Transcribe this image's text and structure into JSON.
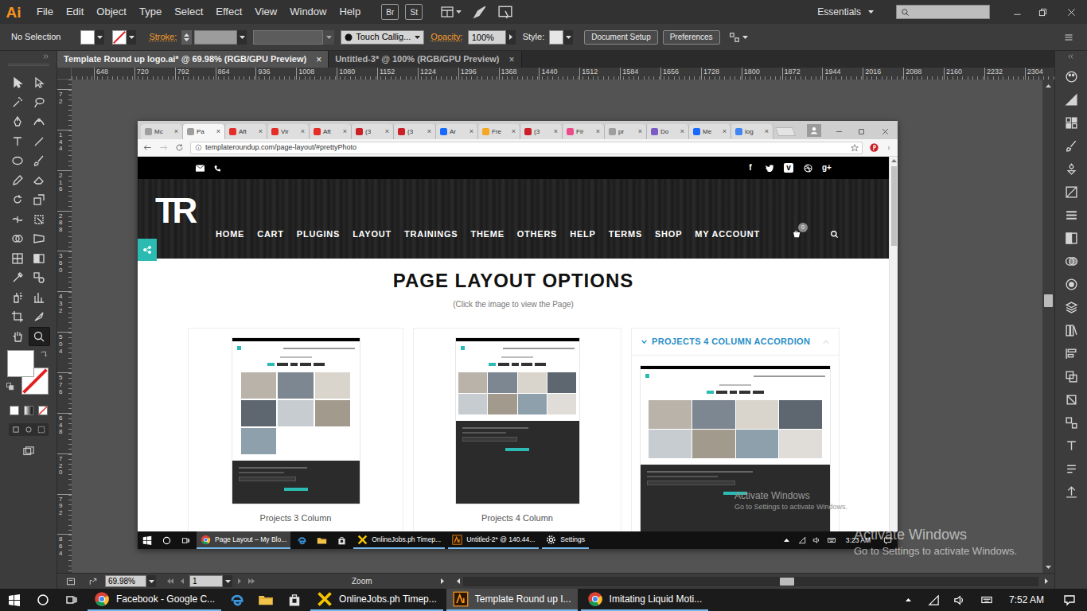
{
  "app": {
    "logo": "Ai",
    "menus": [
      "File",
      "Edit",
      "Object",
      "Type",
      "Select",
      "Effect",
      "View",
      "Window",
      "Help"
    ],
    "bridge": "Br",
    "stock": "St",
    "workspace": "Essentials"
  },
  "control_bar": {
    "selection": "No Selection",
    "fill": {
      "none": false
    },
    "stroke": {
      "none": true
    },
    "stroke_label": "Stroke:",
    "brush": "Touch Callig...",
    "opacity_label": "Opacity:",
    "opacity": "100%",
    "style_label": "Style:",
    "buttons": [
      "Document Setup",
      "Preferences"
    ]
  },
  "doc_tabs": [
    {
      "label": "Template Round up logo.ai* @ 69.98% (RGB/GPU Preview)",
      "close": "×",
      "selected": true
    },
    {
      "label": "Untitled-3* @ 100% (RGB/GPU Preview)",
      "close": "×",
      "selected": false
    }
  ],
  "tools": [
    {
      "kind": "selection",
      "selected": false
    },
    {
      "kind": "direct-selection",
      "selected": false
    },
    {
      "kind": "magic-wand",
      "selected": false
    },
    {
      "kind": "lasso",
      "selected": false
    },
    {
      "kind": "pen",
      "selected": false
    },
    {
      "kind": "curvature",
      "selected": false
    },
    {
      "kind": "type",
      "selected": false
    },
    {
      "kind": "line",
      "selected": false
    },
    {
      "kind": "ellipse",
      "selected": false
    },
    {
      "kind": "paintbrush",
      "selected": false
    },
    {
      "kind": "pencil",
      "selected": false
    },
    {
      "kind": "eraser",
      "selected": false
    },
    {
      "kind": "rotate",
      "selected": false
    },
    {
      "kind": "scale",
      "selected": false
    },
    {
      "kind": "width",
      "selected": false
    },
    {
      "kind": "free-transform",
      "selected": false
    },
    {
      "kind": "shape-builder",
      "selected": false
    },
    {
      "kind": "perspective",
      "selected": false
    },
    {
      "kind": "mesh",
      "selected": false
    },
    {
      "kind": "gradient",
      "selected": false
    },
    {
      "kind": "eyedropper",
      "selected": false
    },
    {
      "kind": "blend",
      "selected": false
    },
    {
      "kind": "symbol-sprayer",
      "selected": false
    },
    {
      "kind": "graph",
      "selected": false
    },
    {
      "kind": "artboard",
      "selected": false
    },
    {
      "kind": "slice",
      "selected": false
    },
    {
      "kind": "hand",
      "selected": false
    },
    {
      "kind": "zoom",
      "selected": true
    }
  ],
  "toolbox": {
    "fill": {
      "none": false
    },
    "stroke": {
      "none": true
    }
  },
  "rulers": {
    "horizontal": [
      "648",
      "720",
      "792",
      "864",
      "936",
      "1008",
      "1080",
      "1152",
      "1224",
      "1296",
      "1368",
      "1440",
      "1512",
      "1584",
      "1656",
      "1728",
      "1800",
      "1872",
      "1944",
      "2016",
      "2088",
      "2160",
      "2232",
      "2304"
    ],
    "vertical": [
      "72",
      "144",
      "216",
      "288",
      "360",
      "432",
      "504",
      "576",
      "648",
      "720",
      "792",
      "864"
    ]
  },
  "status_bar": {
    "zoom": "69.98%",
    "artboard": "1",
    "tool": "Zoom"
  },
  "browser": {
    "tabs": [
      {
        "label": "Mc",
        "close": "×",
        "selected": false,
        "color": "#9e9e9e"
      },
      {
        "label": "Pa",
        "close": "×",
        "selected": true,
        "color": "#9e9e9e"
      },
      {
        "label": "Aft",
        "close": "×",
        "selected": false,
        "color": "#e52d27"
      },
      {
        "label": "Vir",
        "close": "×",
        "selected": false,
        "color": "#e52d27"
      },
      {
        "label": "Aft",
        "close": "×",
        "selected": false,
        "color": "#e52d27"
      },
      {
        "label": "(3",
        "close": "×",
        "selected": false,
        "color": "#cb2027"
      },
      {
        "label": "(3",
        "close": "×",
        "selected": false,
        "color": "#cb2027"
      },
      {
        "label": "Ar",
        "close": "×",
        "selected": false,
        "color": "#1769ff"
      },
      {
        "label": "Fre",
        "close": "×",
        "selected": false,
        "color": "#f5a623"
      },
      {
        "label": "(3",
        "close": "×",
        "selected": false,
        "color": "#cb2027"
      },
      {
        "label": "Fir",
        "close": "×",
        "selected": false,
        "color": "#ea4c89"
      },
      {
        "label": "pr",
        "close": "×",
        "selected": false,
        "color": "#9e9e9e"
      },
      {
        "label": "Do",
        "close": "×",
        "selected": false,
        "color": "#7b5cc4"
      },
      {
        "label": "Me",
        "close": "×",
        "selected": false,
        "color": "#1769ff"
      },
      {
        "label": "log",
        "close": "×",
        "selected": false,
        "color": "#4285f4"
      }
    ],
    "url": "templateroundup.com/page-layout/#prettyPhoto",
    "site": {
      "logo": "TR",
      "social": [
        {
          "kind": "facebook",
          "glyph": "f"
        },
        {
          "kind": "twitter"
        },
        {
          "kind": "vimeo",
          "glyph": "v"
        },
        {
          "kind": "dribbble"
        },
        {
          "kind": "google-plus",
          "glyph": "g+"
        }
      ],
      "nav": [
        "HOME",
        "CART",
        "PLUGINS",
        "LAYOUT",
        "TRAININGS",
        "THEME",
        "OTHERS",
        "HELP",
        "TERMS",
        "SHOP",
        "MY ACCOUNT"
      ],
      "cart_count": "0",
      "heading": "PAGE LAYOUT OPTIONS",
      "subheading": "(Click the image to view the Page)",
      "cards": [
        {
          "caption": "Projects 3 Column",
          "kind": "three-column"
        },
        {
          "caption": "Projects 4 Column",
          "kind": "four-column"
        }
      ],
      "accordion": {
        "title": "PROJECTS 4 COLUMN ACCORDION",
        "expanded": true
      }
    },
    "taskbar": {
      "items": [
        {
          "kind": "chrome",
          "label": "Page Layout – My Blo...",
          "selected": true
        },
        {
          "kind": "edge",
          "selected": false
        },
        {
          "kind": "explorer",
          "selected": false
        },
        {
          "kind": "store",
          "selected": false
        },
        {
          "kind": "onlinejobs",
          "label": "OnlineJobs.ph Timep...",
          "selected": false
        },
        {
          "kind": "illustrator",
          "label": "Untitled-2* @ 140.44...",
          "selected": false
        },
        {
          "kind": "settings",
          "label": "Settings",
          "selected": false
        }
      ],
      "time": "3:23 AM"
    },
    "watermark": {
      "title": "Activate Windows",
      "subtitle": "Go to Settings to activate Windows."
    }
  },
  "taskbar": {
    "items": [
      {
        "kind": "chrome",
        "label": "Facebook - Google C...",
        "selected": false
      },
      {
        "kind": "edge",
        "selected": false
      },
      {
        "kind": "explorer",
        "selected": false
      },
      {
        "kind": "store",
        "selected": false
      },
      {
        "kind": "onlinejobs",
        "label": "OnlineJobs.ph Timep...",
        "selected": false
      },
      {
        "kind": "illustrator",
        "label": "Template Round up I...",
        "selected": true
      },
      {
        "kind": "chrome",
        "label": "Imitating Liquid Moti...",
        "selected": false
      }
    ],
    "time": "7:52 AM"
  },
  "watermark": {
    "title": "Activate Windows",
    "subtitle": "Go to Settings to activate Windows."
  }
}
